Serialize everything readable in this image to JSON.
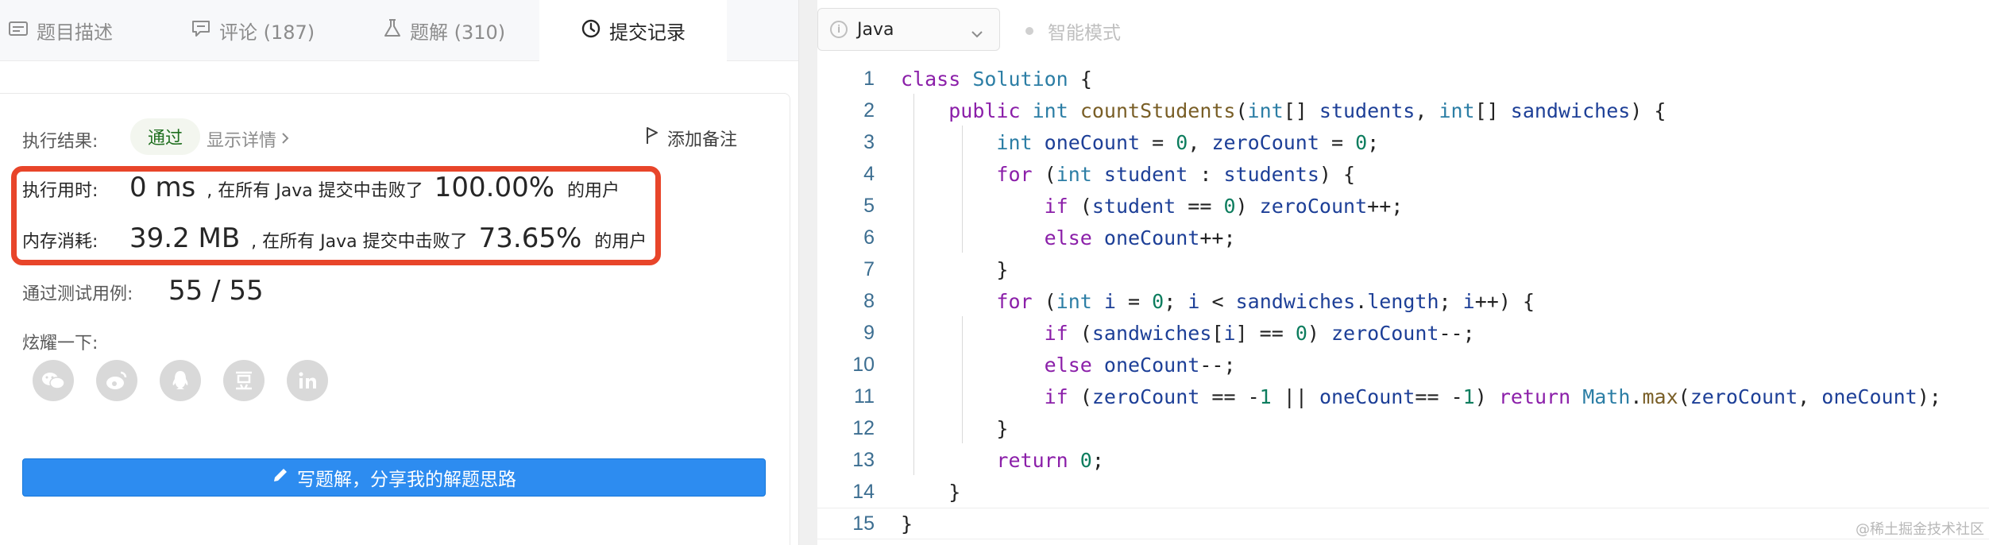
{
  "tabs": [
    {
      "label": "题目描述",
      "icon": "description-icon"
    },
    {
      "label": "评论 (187)",
      "icon": "comment-icon"
    },
    {
      "label": "题解 (310)",
      "icon": "flask-icon"
    },
    {
      "label": "提交记录",
      "icon": "clock-icon",
      "active": true
    }
  ],
  "result": {
    "label": "执行结果:",
    "status": "通过",
    "details_link": "显示详情",
    "add_note": "添加备注"
  },
  "runtime": {
    "label": "执行用时:",
    "value": "0 ms",
    "text": ", 在所有 Java 提交中击败了",
    "percent": "100.00%",
    "suffix": "的用户"
  },
  "memory": {
    "label": "内存消耗:",
    "value": "39.2 MB",
    "text": ", 在所有 Java 提交中击败了",
    "percent": "73.65%",
    "suffix": "的用户"
  },
  "tests": {
    "label": "通过测试用例:",
    "value": "55 / 55"
  },
  "share": {
    "label": "炫耀一下:",
    "icons": [
      "wechat-icon",
      "weibo-icon",
      "qq-icon",
      "douban-icon",
      "linkedin-icon"
    ]
  },
  "write_solution_button": "写题解，分享我的解题思路",
  "editor": {
    "language": "Java",
    "smart_mode": "智能模式",
    "current_line": 15
  },
  "code_lines": [
    "class Solution {",
    "    public int countStudents(int[] students, int[] sandwiches) {",
    "        int oneCount = 0, zeroCount = 0;",
    "        for (int student : students) {",
    "            if (student == 0) zeroCount++;",
    "            else oneCount++;",
    "        }",
    "        for (int i = 0; i < sandwiches.length; i++) {",
    "            if (sandwiches[i] == 0) zeroCount--;",
    "            else oneCount--;",
    "            if (zeroCount == -1 || oneCount== -1) return Math.max(zeroCount, oneCount);",
    "        }",
    "        return 0;",
    "    }",
    "}"
  ],
  "watermark": "@稀土掘金技术社区",
  "colors": {
    "accent_button": "#2d8cf0",
    "highlight_border": "#e8452a",
    "status_pass": "#1f6f1f"
  }
}
